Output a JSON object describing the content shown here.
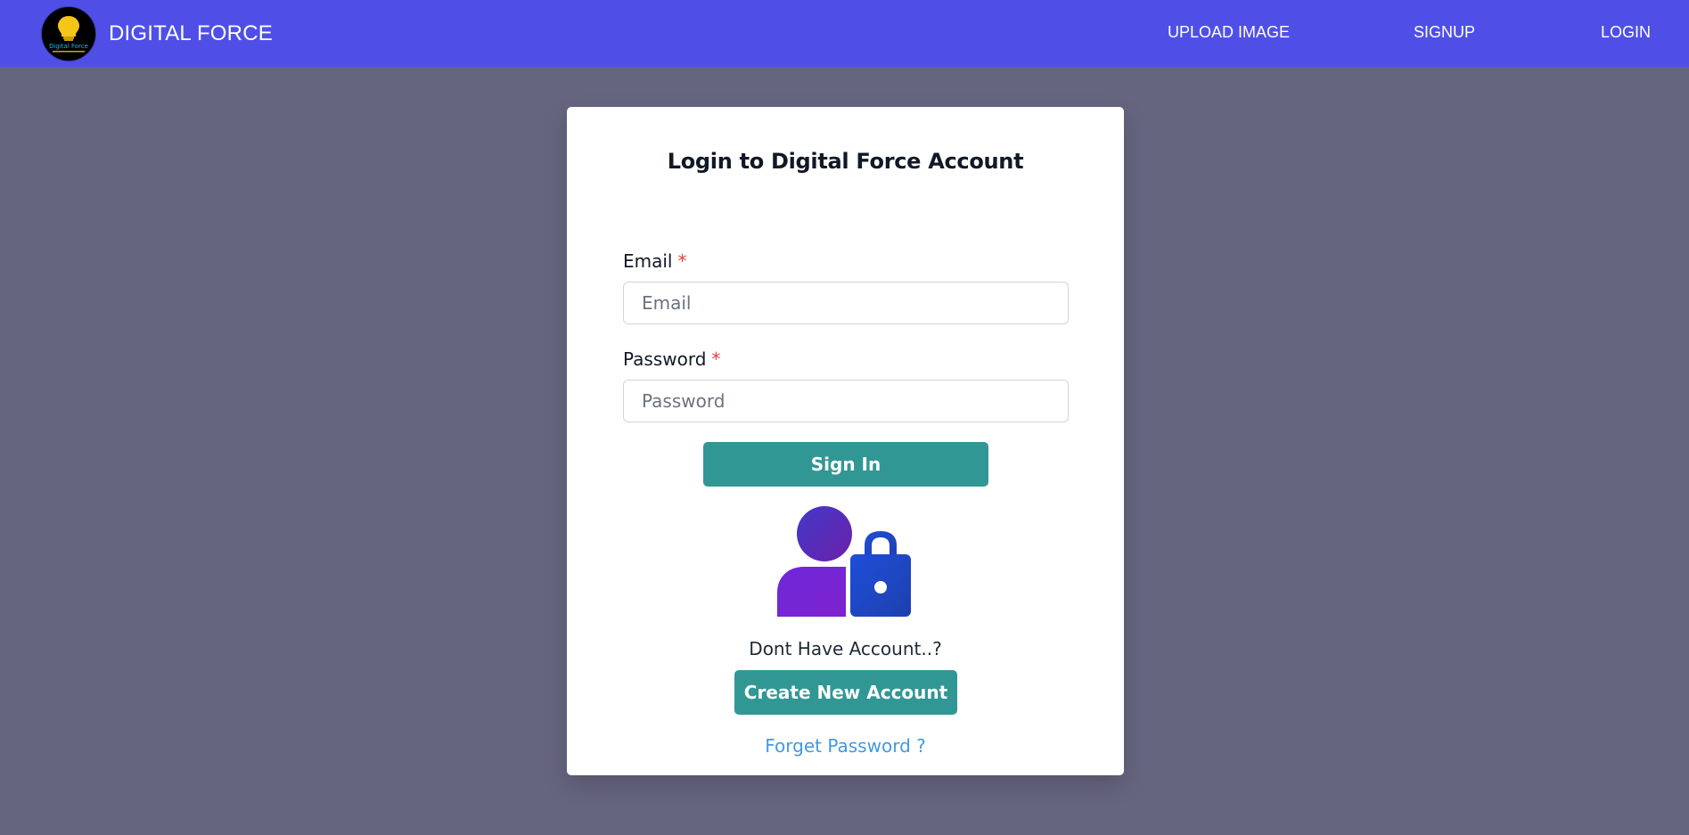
{
  "navbar": {
    "brand": "DIGITAL FORCE",
    "logo_text": "Digital Force",
    "links": [
      "UPLOAD IMAGE",
      "SIGNUP",
      "LOGIN"
    ]
  },
  "login": {
    "title": "Login to Digital Force Account",
    "email_label": "Email",
    "email_placeholder": "Email",
    "password_label": "Password",
    "password_placeholder": "Password",
    "required_mark": "*",
    "sign_in_label": "Sign In",
    "no_account_text": "Dont Have Account..?",
    "create_account_label": "Create New Account",
    "forgot_password_label": "Forget Password ?"
  },
  "colors": {
    "navbar": "#4f4fe8",
    "background": "#666580",
    "button": "#319795",
    "link": "#4299e1",
    "required": "#e53e3e"
  },
  "icons": {
    "logo": "lightbulb-logo",
    "illustration": "user-lock-icon"
  }
}
